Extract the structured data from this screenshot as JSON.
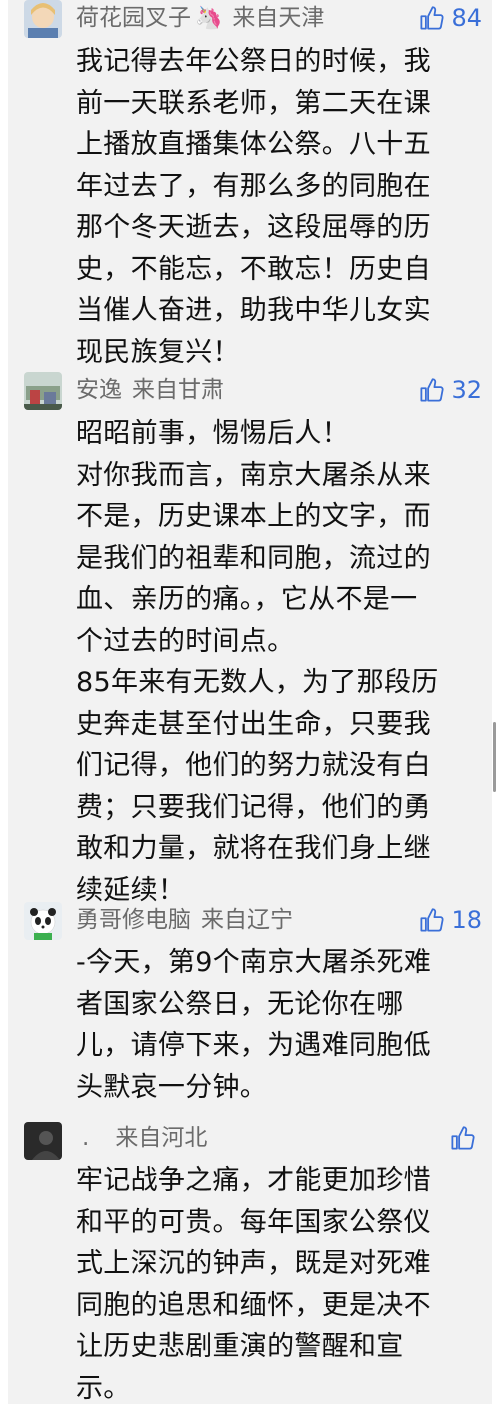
{
  "comments": [
    {
      "user": "荷花园叉子",
      "from": "来自天津",
      "likes": "84",
      "lines": [
        "我记得去年公祭日的时候，我",
        "前一天联系老师，第二天在课",
        "上播放直播集体公祭。八十五",
        "年过去了，有那么多的同胞在",
        "那个冬天逝去，这段屈辱的历",
        "史，不能忘，不敢忘！历史自",
        "当催人奋进，助我中华儿女实",
        "现民族复兴！"
      ]
    },
    {
      "user": "安逸",
      "from": "来自甘肃",
      "likes": "32",
      "lines": [
        "昭昭前事，惕惕后人！",
        "对你我而言，南京大屠杀从来",
        "不是，历史课本上的文字，而",
        "是我们的祖辈和同胞，流过的",
        "血、亲历的痛。，它从不是一",
        "个过去的时间点。",
        "85年来有无数人，为了那段历",
        "史奔走甚至付出生命，只要我",
        "们记得，他们的努力就没有白",
        "费；只要我们记得，他们的勇",
        "敢和力量，就将在我们身上继",
        "续延续！"
      ]
    },
    {
      "user": "勇哥修电脑",
      "from": "来自辽宁",
      "likes": "18",
      "lines": [
        "-今天，第9个南京大屠杀死难",
        "者国家公祭日，无论你在哪",
        "儿，请停下来，为遇难同胞低",
        "头默哀一分钟。"
      ]
    },
    {
      "user": ".",
      "from": "来自河北",
      "likes": "",
      "lines": [
        "牢记战争之痛，才能更加珍惜",
        "和平的可贵。每年国家公祭仪",
        "式上深沉的钟声，既是对死难",
        "同胞的追思和缅怀，更是决不",
        "让历史悲剧重演的警醒和宣",
        "示。"
      ]
    }
  ],
  "icons": {
    "like": "thumbs-up-icon",
    "badge": "unicorn-icon"
  },
  "colors": {
    "like_blue": "#3a6fd8",
    "meta_gray": "#6b6b6b",
    "text": "#111111",
    "panel_bg": "#f2f2f2"
  }
}
